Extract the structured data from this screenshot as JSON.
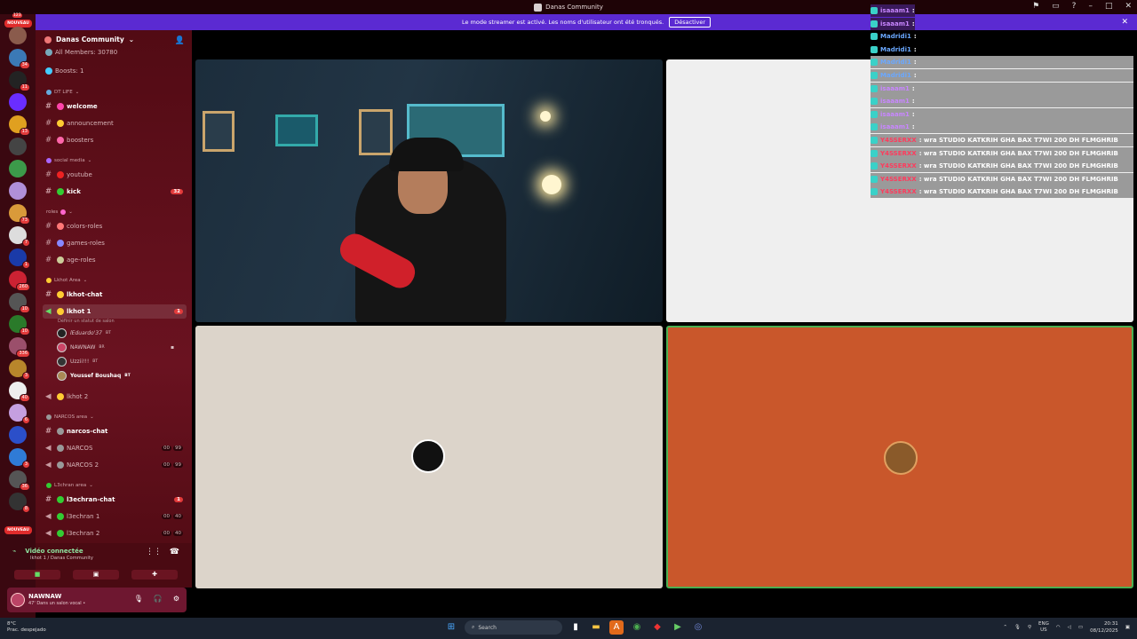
{
  "window": {
    "title": "Danas Community"
  },
  "banner": {
    "text": "Le mode streamer est activé. Les noms d'utilisateur ont été tronqués.",
    "button": "Désactiver"
  },
  "rail": {
    "top_badge": "NOUVEAU",
    "top_count": "123",
    "bottom_badge": "NOUVEAU",
    "servers": [
      {
        "color": "#8a5b4c",
        "count": ""
      },
      {
        "color": "#3b79b6",
        "count": "34"
      },
      {
        "color": "#232323",
        "count": "11"
      },
      {
        "color": "#6a2dff",
        "count": ""
      },
      {
        "color": "#e0a020",
        "count": "13"
      },
      {
        "color": "#444",
        "count": ""
      },
      {
        "color": "#3c9a4a",
        "count": ""
      },
      {
        "color": "#b08fd8",
        "count": ""
      },
      {
        "color": "#d99a3a",
        "count": "73"
      },
      {
        "color": "#ddd",
        "count": "7"
      },
      {
        "color": "#1a3aa8",
        "count": "1"
      },
      {
        "color": "#c23",
        "count": "260"
      },
      {
        "color": "#555",
        "count": "10"
      },
      {
        "color": "#2a7a2a",
        "count": "10"
      },
      {
        "color": "#9b4f6b",
        "count": "336"
      },
      {
        "color": "#b8862b",
        "count": "3"
      },
      {
        "color": "#eee",
        "count": "40"
      },
      {
        "color": "#c59fe0",
        "count": "6"
      },
      {
        "color": "#2b4fc9",
        "count": ""
      },
      {
        "color": "#2f7bd6",
        "count": "3"
      },
      {
        "color": "#555",
        "count": "36"
      },
      {
        "color": "#333",
        "count": "8"
      }
    ]
  },
  "guild": {
    "name": "Danas Community"
  },
  "channels": {
    "members_row": "All Members: 30780",
    "boosts_row": "Boosts: 1",
    "cat_dtlife": "DT LIFE",
    "welcome": "welcome",
    "announcement": "announcement",
    "boosters": "boosters",
    "cat_social": "social media",
    "youtube": "youtube",
    "kick": "kick",
    "kick_unread": "32",
    "cat_roles": "roles",
    "colors_roles": "colors-roles",
    "games_roles": "games-roles",
    "age_roles": "age-roles",
    "cat_lkhot": "Lkhot Area",
    "lkhot_chat": "lkhot-chat",
    "lkhot1": "lkhot 1",
    "lkhot1_unread": "1",
    "lkhot1_status": "Définir un statut de salon",
    "users": [
      {
        "name": "lEduardo'37",
        "tag": "BT"
      },
      {
        "name": "NAWNAW",
        "tag": "BR"
      },
      {
        "name": "Uzzii!!!",
        "tag": "BT"
      },
      {
        "name": "Youssef Boushaq",
        "tag": "BT"
      }
    ],
    "lkhot2": "lkhot 2",
    "cat_narcos": "NARCOS area",
    "narcos_chat": "narcos-chat",
    "narcos": "NARCOS",
    "narcos2": "NARCOS 2",
    "narcos_cnt": [
      "00",
      "99"
    ],
    "narcos2_cnt": [
      "00",
      "99"
    ],
    "cat_l3": "L3chran area",
    "l3_chat": "l3echran-chat",
    "l3_chat_unread": "1",
    "l3_1": "l3echran 1",
    "l3_2": "l3echran 2",
    "l3_1_cnt": [
      "00",
      "40"
    ],
    "l3_2_cnt": [
      "00",
      "40"
    ]
  },
  "voice": {
    "status": "Vidéo connectée",
    "channel": "lkhot 1 / Danas Community"
  },
  "user": {
    "name": "NAWNAW",
    "status": "47' Dans un salon vocal •"
  },
  "chat": [
    {
      "name": "isaaam1",
      "text": ":",
      "color": "#c886ff",
      "style": "dark"
    },
    {
      "name": "isaaam1",
      "text": ":",
      "color": "#c886ff",
      "style": "dark"
    },
    {
      "name": "Madridi1",
      "text": ":",
      "color": "#6aa8ff",
      "style": "dark"
    },
    {
      "name": "Madridi1",
      "text": ":",
      "color": "#6aa8ff",
      "style": "dark"
    },
    {
      "name": "Madridi1",
      "text": ":",
      "color": "#6aa8ff",
      "style": "gray"
    },
    {
      "name": "Madridi1",
      "text": ":",
      "color": "#6aa8ff",
      "style": "gray"
    },
    {
      "name": "isaaam1",
      "text": ":",
      "color": "#c886ff",
      "style": "gray"
    },
    {
      "name": "isaaam1",
      "text": ":",
      "color": "#c886ff",
      "style": "gray"
    },
    {
      "name": "isaaam1",
      "text": ":",
      "color": "#c886ff",
      "style": "gray"
    },
    {
      "name": "isaaam1",
      "text": ":",
      "color": "#c886ff",
      "style": "gray"
    },
    {
      "name": "Y4SSERXX",
      "text": ": wra STUDIO KATKRIH GHA BAX T7WI 200 DH FLMGHRIB",
      "color": "#ff3a5c",
      "style": "gray"
    },
    {
      "name": "Y4SSERXX",
      "text": ": wra STUDIO KATKRIH GHA BAX T7WI 200 DH FLMGHRIB",
      "color": "#ff3a5c",
      "style": "gray"
    },
    {
      "name": "Y4SSERXX",
      "text": ": wra STUDIO KATKRIH GHA BAX T7WI 200 DH FLMGHRIB",
      "color": "#ff3a5c",
      "style": "gray"
    },
    {
      "name": "Y4SSERXX",
      "text": ": wra STUDIO KATKRIH GHA BAX T7WI 200 DH FLMGHRIB",
      "color": "#ff3a5c",
      "style": "gray"
    },
    {
      "name": "Y4SSERXX",
      "text": ": wra STUDIO KATKRIH GHA BAX T7WI 200 DH FLMGHRIB",
      "color": "#ff3a5c",
      "style": "gray"
    }
  ],
  "taskbar": {
    "weather_temp": "8°C",
    "weather_desc": "Prac. despejado",
    "search": "Search",
    "lang1": "ENG",
    "lang2": "US",
    "time": "20:31",
    "date": "08/12/2025"
  },
  "colors": {
    "accent": "#5b2ad2",
    "sidebar": "#5a0d17",
    "speaking": "#4bb053"
  }
}
